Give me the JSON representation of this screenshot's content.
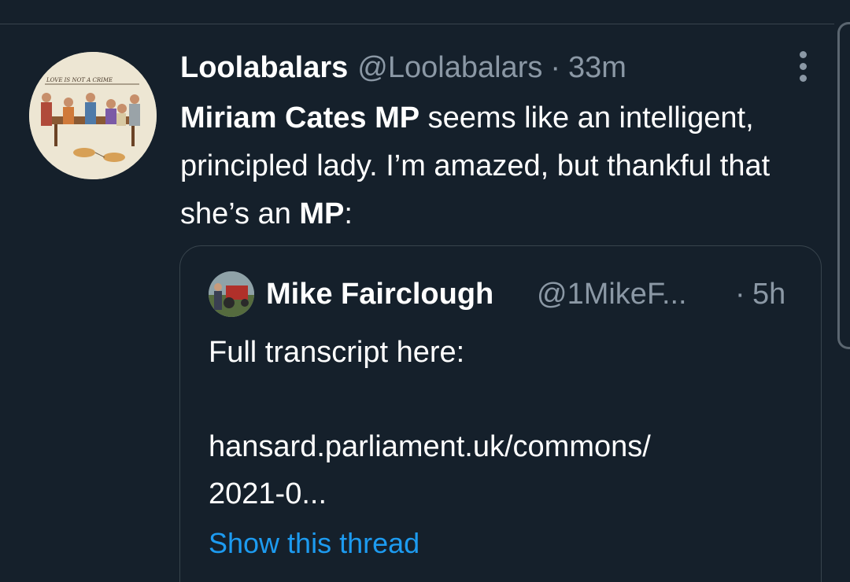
{
  "tweet": {
    "author_name": "Loolabalars",
    "author_handle": "@Loolabalars",
    "separator": "·",
    "time": "33m",
    "avatar_caption": "LOVE IS NOT A CRIME",
    "text_segments": [
      {
        "text": "Miriam Cates MP",
        "bold": true
      },
      {
        "text": " seems like an intelligent, principled lady. I’m amazed, but thankful that she’s an ",
        "bold": false
      },
      {
        "text": "MP",
        "bold": true
      },
      {
        "text": ":",
        "bold": false
      }
    ]
  },
  "quoted_tweet": {
    "author_name": "Mike Fairclough",
    "author_handle": "@1MikeF...",
    "separator": "·",
    "time": "5h",
    "lines": [
      "Full transcript here:",
      "",
      "hansard.parliament.uk/commons/",
      "2021-0..."
    ],
    "show_thread_label": "Show this thread"
  },
  "colors": {
    "background": "#15202b",
    "border": "#38444d",
    "secondary_text": "#8b98a5",
    "link": "#1d9bf0"
  },
  "icons": {
    "more": "more-vertical-icon"
  }
}
